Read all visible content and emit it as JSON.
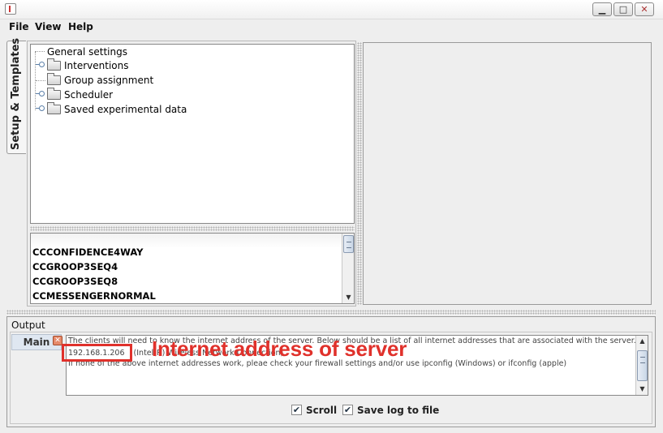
{
  "window": {
    "buttons": {
      "minimize": "▁",
      "maximize": "□",
      "close": "✕"
    }
  },
  "menu": {
    "items": [
      "File",
      "View",
      "Help"
    ]
  },
  "sidetab": {
    "label": "Setup & Templates"
  },
  "tree": {
    "root": "General settings",
    "items": [
      {
        "label": "Interventions",
        "expandable": true
      },
      {
        "label": "Group assignment",
        "expandable": false
      },
      {
        "label": "Scheduler",
        "expandable": true
      },
      {
        "label": "Saved experimental data",
        "expandable": true
      }
    ]
  },
  "templates": {
    "items": [
      "CCCONFIDENCE4WAY",
      "CCGROOP3SEQ4",
      "CCGROOP3SEQ8",
      "CCMESSENGERNORMAL"
    ]
  },
  "output": {
    "label": "Output",
    "tab": "Main",
    "log": {
      "line1": "The clients will need to know the internet address of the server. Below should be a list of all internet addresses that are associated with the server.",
      "ip": "192.168.1.206",
      "line2_rest": "(Intel(R) Wireless Network Connection)",
      "line3": "If none of the above internet addresses work, pleae check your firewall settings and/or use ipconfig (Windows) or ifconfig (apple)"
    },
    "scroll_label": "Scroll",
    "save_log_label": "Save log to file",
    "scroll_checked": true,
    "save_log_checked": true
  },
  "annotation": {
    "text": "Internet address of server",
    "color": "#e0312b"
  }
}
